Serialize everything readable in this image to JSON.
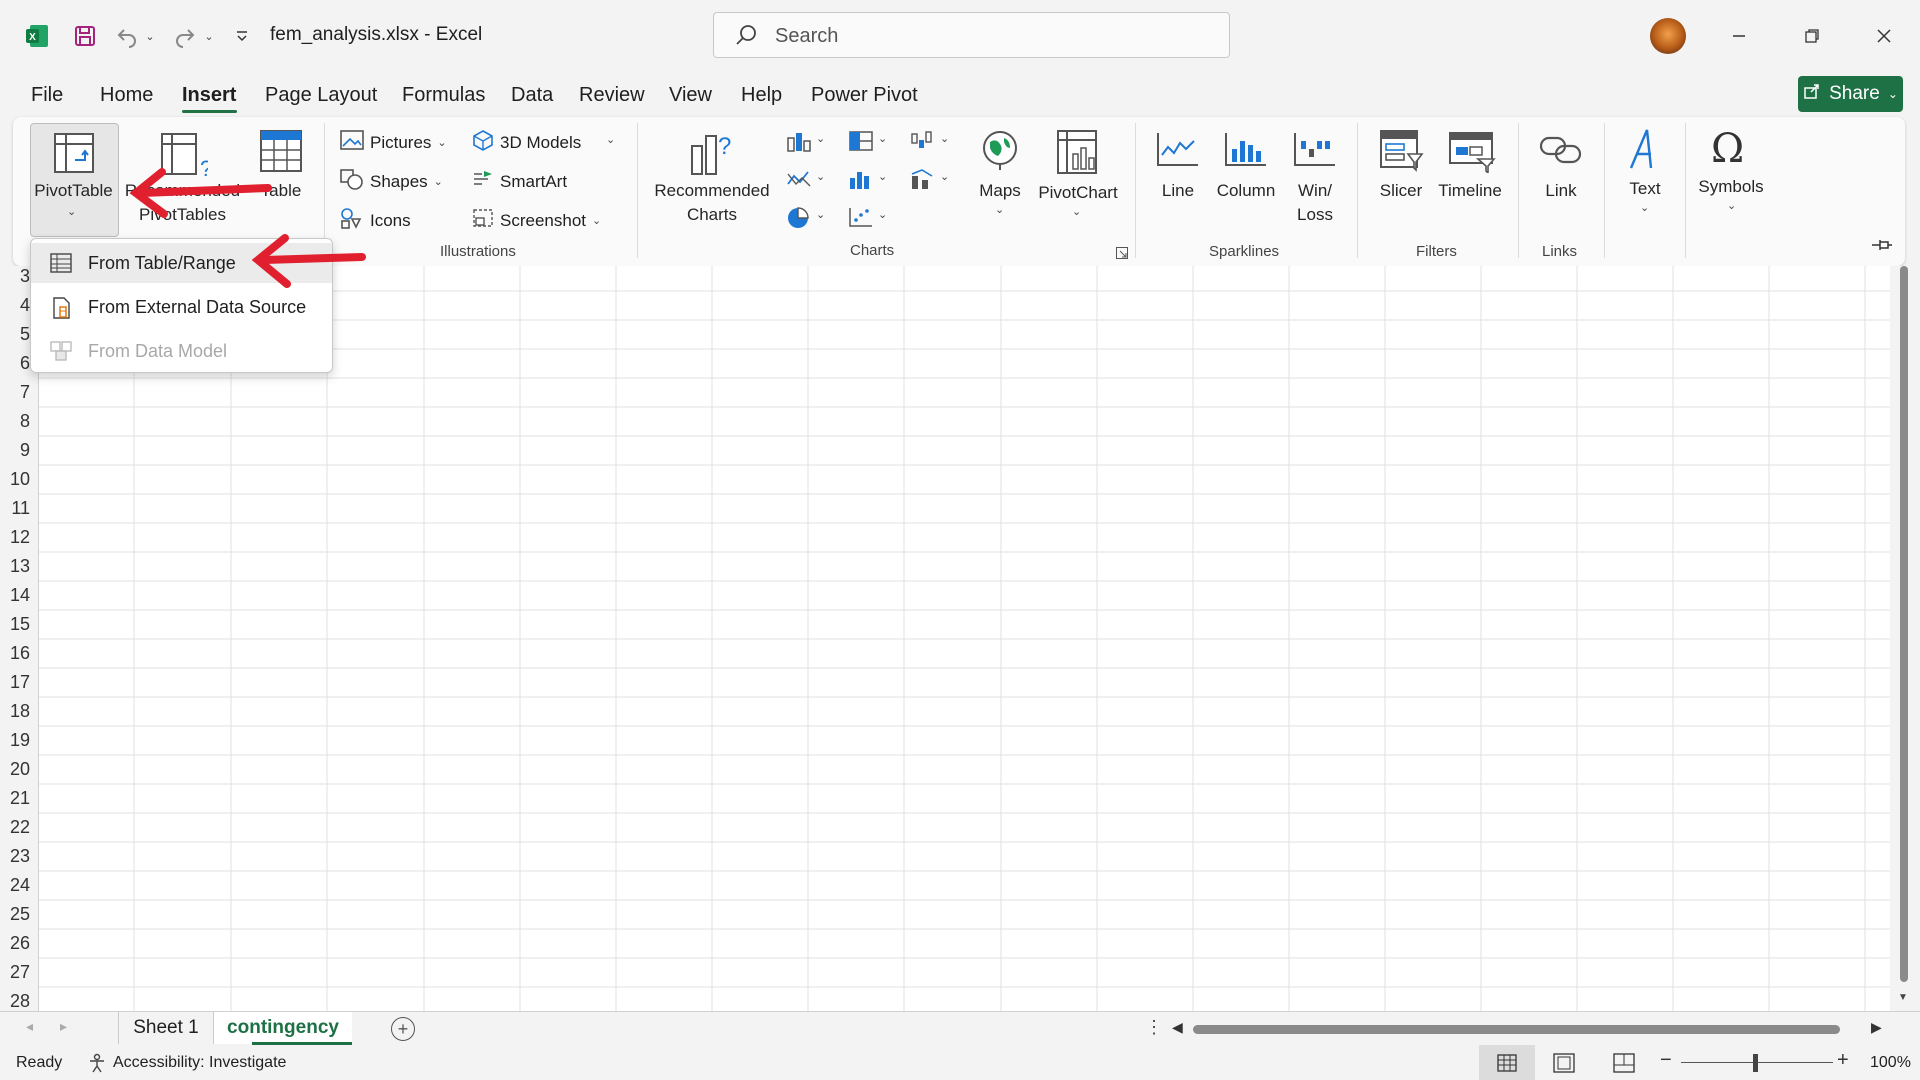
{
  "window": {
    "file_title": "fem_analysis.xlsx  -  Excel",
    "search_placeholder": "Search"
  },
  "menu": {
    "tabs": [
      "File",
      "Home",
      "Insert",
      "Page Layout",
      "Formulas",
      "Data",
      "Review",
      "View",
      "Help",
      "Power Pivot"
    ],
    "active": "Insert",
    "share_label": "Share"
  },
  "ribbon": {
    "tables": {
      "pivottable": "PivotTable",
      "recommended_line1": "Recommended",
      "recommended_line2": "PivotTables",
      "table": "Table"
    },
    "illustrations": {
      "pictures": "Pictures",
      "shapes": "Shapes",
      "icons": "Icons",
      "models3d": "3D Models",
      "smartart": "SmartArt",
      "screenshot": "Screenshot",
      "group_label": "Illustrations"
    },
    "charts": {
      "recommended_line1": "Recommended",
      "recommended_line2": "Charts",
      "maps": "Maps",
      "pivotchart": "PivotChart",
      "group_label": "Charts"
    },
    "sparklines": {
      "line": "Line",
      "column": "Column",
      "winloss_line1": "Win/",
      "winloss_line2": "Loss",
      "group_label": "Sparklines"
    },
    "filters": {
      "slicer": "Slicer",
      "timeline": "Timeline",
      "group_label": "Filters"
    },
    "links": {
      "link": "Link",
      "group_label": "Links"
    },
    "text": {
      "label": "Text"
    },
    "symbols": {
      "label": "Symbols"
    }
  },
  "dropdown": {
    "items": [
      {
        "label": "From Table/Range",
        "enabled": true
      },
      {
        "label": "From External Data Source",
        "enabled": true
      },
      {
        "label": "From Data Model",
        "enabled": false
      }
    ]
  },
  "grid": {
    "rows": [
      "3",
      "4",
      "5",
      "6",
      "7",
      "8",
      "9",
      "10",
      "11",
      "12",
      "13",
      "14",
      "15",
      "16",
      "17",
      "18",
      "19",
      "20",
      "21",
      "22",
      "23",
      "24",
      "25",
      "26",
      "27",
      "28"
    ]
  },
  "sheets": {
    "tabs": [
      "Sheet 1",
      "contingency"
    ],
    "active": "contingency"
  },
  "status": {
    "ready": "Ready",
    "accessibility": "Accessibility: Investigate",
    "zoom": "100%"
  },
  "colors": {
    "accent": "#217346",
    "share_bg": "#1e7145",
    "annotation_arrow": "#e0202e"
  }
}
